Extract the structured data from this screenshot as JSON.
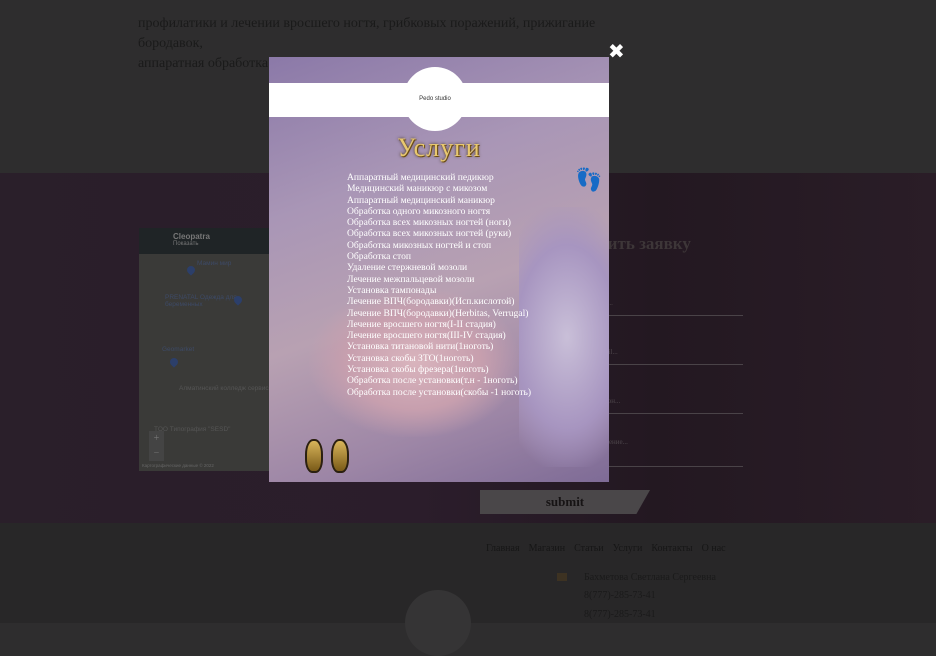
{
  "intro": {
    "lines": [
      "профилатики и лечении вросшего ногтя, грибковых поражений, прижигание бородавок,",
      "аппаратная обработка ногтей и многое другое."
    ]
  },
  "map": {
    "place": "Cleopatra",
    "sub": "Показать",
    "labels": [
      "Мамин мир",
      "PRENATAL Одежда для беременных",
      "Geomarket",
      "Алматинский колледж сервиса",
      "TOO Типография \"SESD\""
    ],
    "zoom_in": "+",
    "zoom_out": "−",
    "footer": "Картографические данные © 2022"
  },
  "form": {
    "title": "авить заявку",
    "placeholders": [
      "мя...",
      "mail...",
      "ефон...",
      "бщение..."
    ],
    "submit": "submit"
  },
  "footer": {
    "nav": [
      "Главная",
      "Магазин",
      "Статьи",
      "Услуги",
      "Контакты",
      "О нас"
    ],
    "name": "Бахметова Светлана Сергеевна",
    "phones": [
      "8(777)-285-73-41",
      "8(777)-285-73-41"
    ]
  },
  "modal": {
    "logo": "Pedo studio",
    "title": "Услуги",
    "close": "✖",
    "services": [
      "Аппаратный медицинский педикюр",
      "Медицинский маникюр с микозом",
      "Аппаратный медицинский маникюр",
      "Обработка одного микозного ногтя",
      "Обработка всех микозных ногтей (ноги)",
      "Обработка всех микозных ногтей (руки)",
      "Обработка микозных ногтей и стоп",
      "Обработка стоп",
      "Удаление стержневой мозоли",
      "Лечение межпальцевой мозоли",
      "Установка тампонады",
      "Лечение ВПЧ(бородавки)(Исп.кислотой)",
      "Лечение ВПЧ(бородавки)(Herbitas, Verrugal)",
      "Лечение вросшего ногтя(I-II стадия)",
      "Лечение вросшего ногтя(III-IV стадия)",
      "Установка титановой нити(1ноготь)",
      "Установка скобы ЗТО(1ноготь)",
      "Установка скобы фрезера(1ноготь)",
      "Обработка после установки(т.н - 1ноготь)",
      "Обработка после установки(скобы -1 ноготь)"
    ]
  }
}
